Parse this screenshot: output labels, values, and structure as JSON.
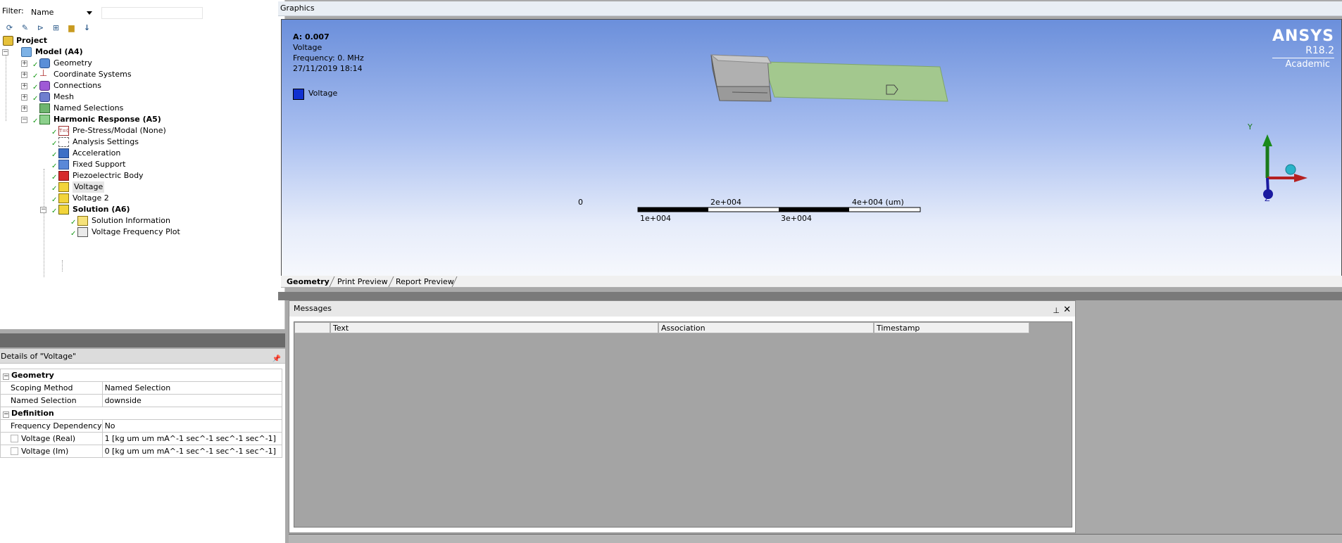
{
  "filter": {
    "label": "Filter:",
    "select_value": "Name",
    "input_value": ""
  },
  "toolbar_icons": [
    "refresh-icon",
    "eraser-icon",
    "expand-icon",
    "plus-box-icon",
    "folder-icon",
    "sort-az-icon"
  ],
  "tree": {
    "project": "Project",
    "model": "Model (A4)",
    "geometry": "Geometry",
    "coordinate_systems": "Coordinate Systems",
    "connections": "Connections",
    "mesh": "Mesh",
    "named_selections": "Named Selections",
    "harmonic_response": "Harmonic Response (A5)",
    "pre_stress": "Pre-Stress/Modal (None)",
    "analysis_settings": "Analysis Settings",
    "acceleration": "Acceleration",
    "fixed_support": "Fixed Support",
    "piezoelectric_body": "Piezoelectric Body",
    "voltage": "Voltage",
    "voltage2": "Voltage 2",
    "solution": "Solution (A6)",
    "solution_information": "Solution Information",
    "voltage_frequency_plot": "Voltage Frequency Plot"
  },
  "details": {
    "title": "Details of \"Voltage\"",
    "groups": {
      "geometry": "Geometry",
      "definition": "Definition"
    },
    "rows": {
      "scoping_method_label": "Scoping Method",
      "scoping_method_value": "Named Selection",
      "named_selection_label": "Named Selection",
      "named_selection_value": "downside",
      "frequency_dependency_label": "Frequency Dependency",
      "frequency_dependency_value": "No",
      "voltage_real_label": "Voltage (Real)",
      "voltage_real_value": "1 [kg um um mA^-1 sec^-1 sec^-1 sec^-1]",
      "voltage_im_label": "Voltage (Im)",
      "voltage_im_value": "0 [kg um um mA^-1 sec^-1 sec^-1 sec^-1]"
    }
  },
  "graphics": {
    "title": "Graphics",
    "legend": {
      "header": "A: 0.007",
      "line1": "Voltage",
      "line2": "Frequency: 0. MHz",
      "line3": "27/11/2019 18:14",
      "item_label": "Voltage",
      "item_color": "#1030d0"
    },
    "logo": {
      "name": "ANSYS",
      "version": "R18.2",
      "edition": "Academic"
    },
    "scale": {
      "top_labels": [
        "0",
        "2e+004",
        "4e+004 (um)"
      ],
      "bottom_labels": [
        "1e+004",
        "3e+004"
      ]
    },
    "axes": {
      "y": "Y",
      "z": "Z"
    },
    "tabs": [
      "Geometry",
      "Print Preview",
      "Report Preview"
    ]
  },
  "messages": {
    "title": "Messages",
    "columns": [
      "",
      "Text",
      "Association",
      "Timestamp"
    ]
  }
}
